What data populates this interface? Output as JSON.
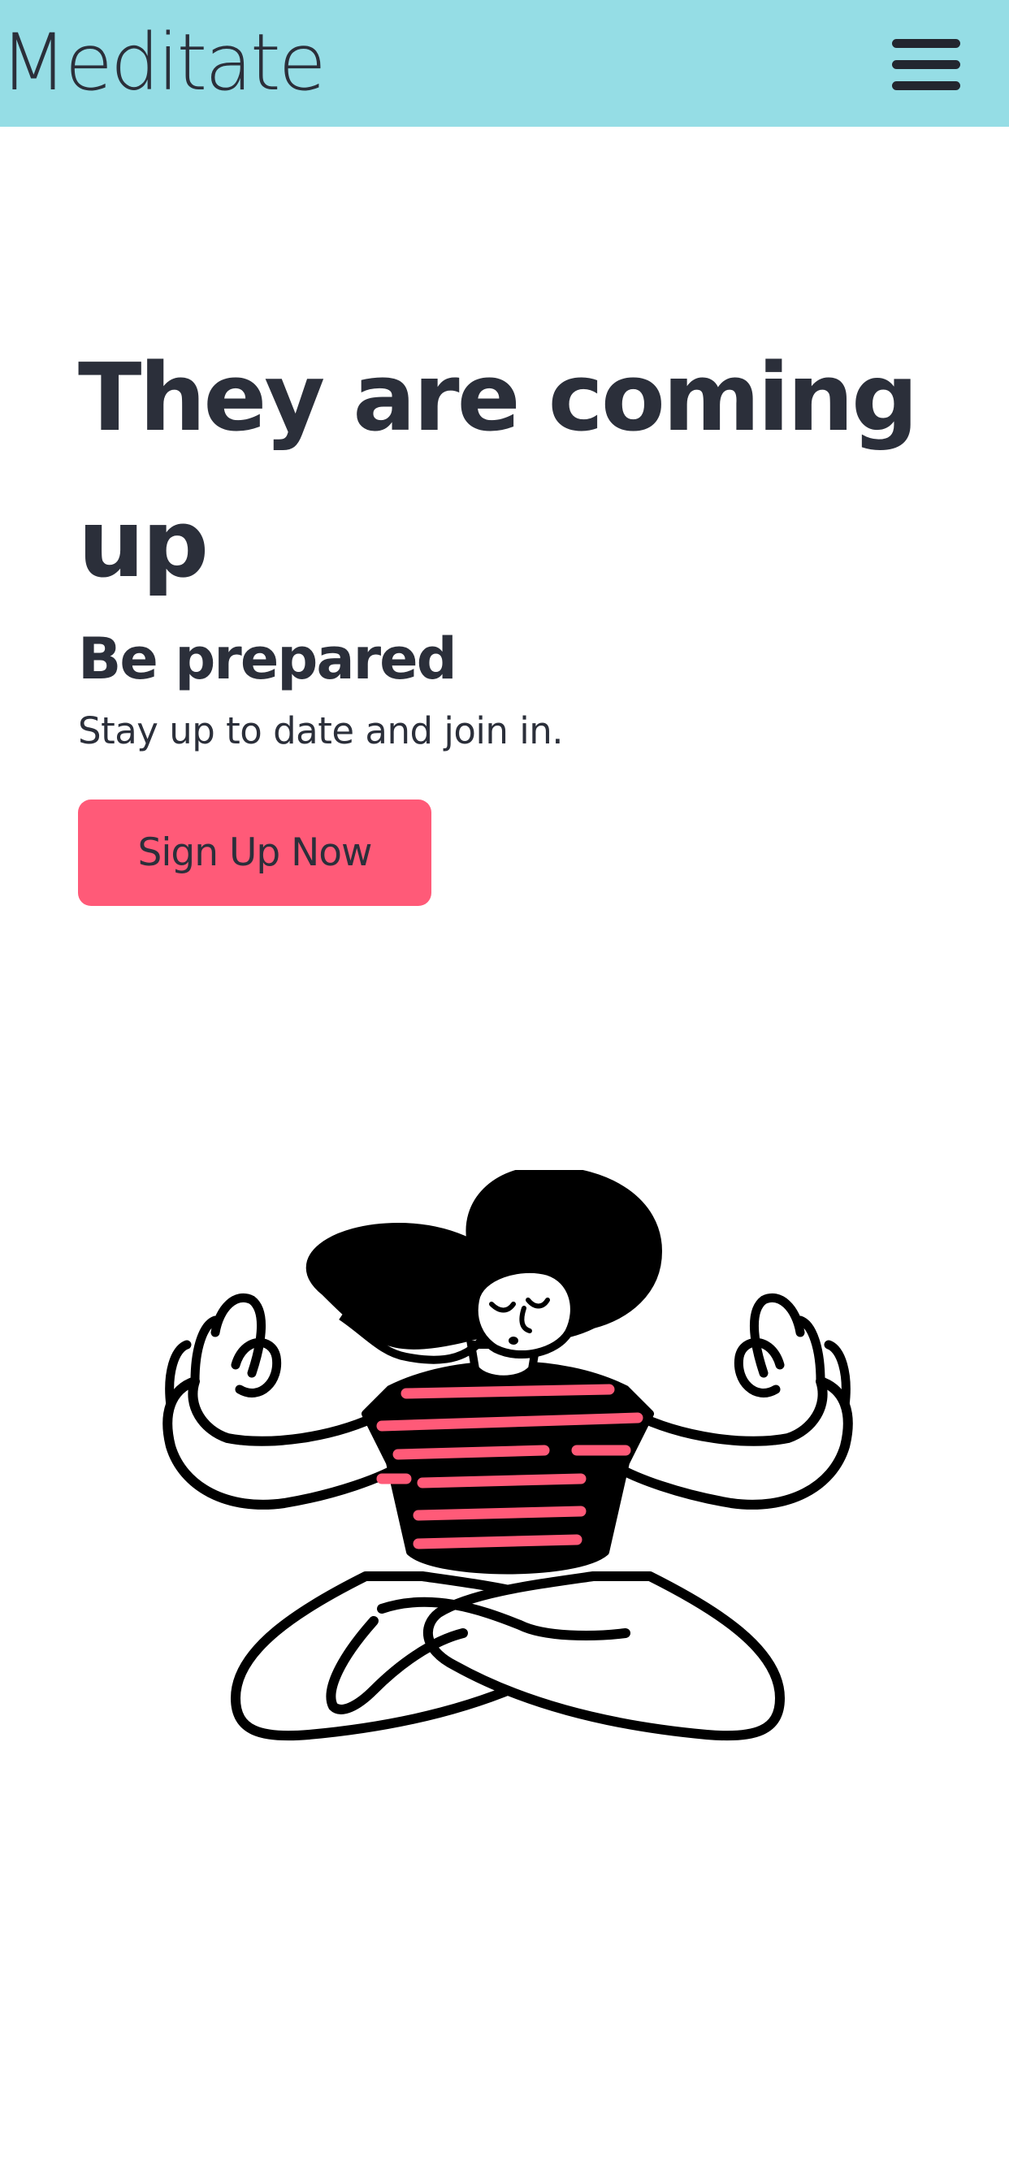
{
  "header": {
    "brand": "Meditate",
    "menu_icon": "hamburger-menu-icon",
    "background_color": "#95dde5"
  },
  "hero": {
    "headline": "They are coming up",
    "subheadline": "Be prepared",
    "tagline": "Stay up to date and join in.",
    "cta_label": "Sign Up Now",
    "cta_color": "#ff5a78"
  },
  "illustration": {
    "icon": "meditating-person-illustration",
    "stripe_color": "#ff5a78"
  }
}
